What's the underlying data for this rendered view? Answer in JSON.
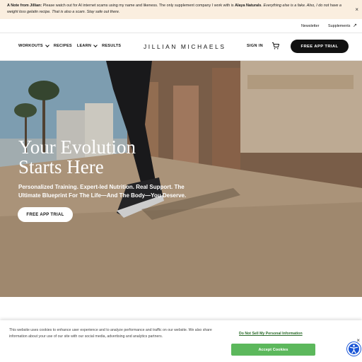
{
  "announcement": {
    "lead": "A Note from Jillian:",
    "text_before": " Please watch out for AI internet scams using my name and likeness. The only supplement company I work with is ",
    "brand": "Alaya Naturals",
    "text_after_italic": ". Everything else is a fake. Also, I do not have a weight loss gelatin recipe. That is also a scam. Stay safe out there.",
    "close_glyph": "×"
  },
  "utility": {
    "newsletter": "Newsletter",
    "supplements": "Supplements",
    "external_icon": "↗"
  },
  "nav": {
    "items": [
      {
        "label": "WORKOUTS",
        "has_dropdown": true
      },
      {
        "label": "RECIPES",
        "has_dropdown": false
      },
      {
        "label": "LEARN",
        "has_dropdown": true
      },
      {
        "label": "RESULTS",
        "has_dropdown": false
      }
    ],
    "logo": "JILLIAN MICHAELS",
    "signin": "SIGN IN",
    "cart_icon": "cart-icon",
    "cta": "FREE APP TRIAL"
  },
  "hero": {
    "title_line1": "Your Evolution",
    "title_line2": "Starts Here",
    "subtitle": "Personalized Training. Expert-led Nutrition. Real Support. The Ultimate Blueprint For The Life—And The Body—You Deserve.",
    "cta": "FREE APP TRIAL"
  },
  "cookie": {
    "text": "This website uses cookies to enhance user experience and to analyze performance and traffic on our website. We also share information about your use of our site with our social media, advertising and analytics partners.",
    "do_not_sell": "Do Not Sell My Personal Information",
    "accept": "Accept Cookies",
    "close_glyph": "×"
  },
  "colors": {
    "announcement_bg": "#faeedf",
    "cta_bg": "#111111",
    "accept_bg": "#5cb85c",
    "accessibility_blue": "#1a55d6"
  }
}
